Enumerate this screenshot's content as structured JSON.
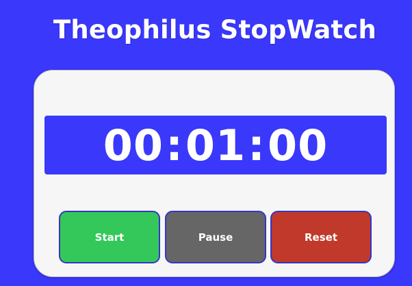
{
  "app": {
    "title": "Theophilus StopWatch"
  },
  "display": {
    "hours": "00",
    "minutes": "01",
    "seconds": "00",
    "separator": ":"
  },
  "controls": {
    "start_label": "Start",
    "pause_label": "Pause",
    "reset_label": "Reset"
  },
  "colors": {
    "background": "#3a38fb",
    "card": "#f6f6f6",
    "display": "#3a38fb",
    "start": "#34c85a",
    "pause": "#666666",
    "reset": "#c0392b",
    "button_border": "#3436c8"
  }
}
